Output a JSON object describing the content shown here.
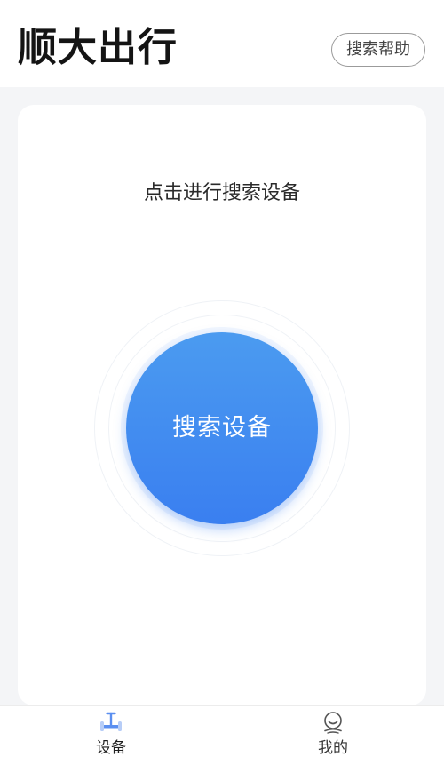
{
  "header": {
    "app_title": "顺大出行",
    "help_button_label": "搜索帮助"
  },
  "main": {
    "prompt_text": "点击进行搜索设备",
    "search_button_label": "搜索设备"
  },
  "tabbar": {
    "tabs": [
      {
        "label": "设备",
        "icon": "scooter-icon",
        "active": true
      },
      {
        "label": "我的",
        "icon": "profile-icon",
        "active": false
      }
    ]
  },
  "colors": {
    "accent": "#3a7ff0",
    "accent_light": "#4b9bf0",
    "background": "#f4f5f7",
    "active_tab_icon": "#5b8ff0"
  }
}
